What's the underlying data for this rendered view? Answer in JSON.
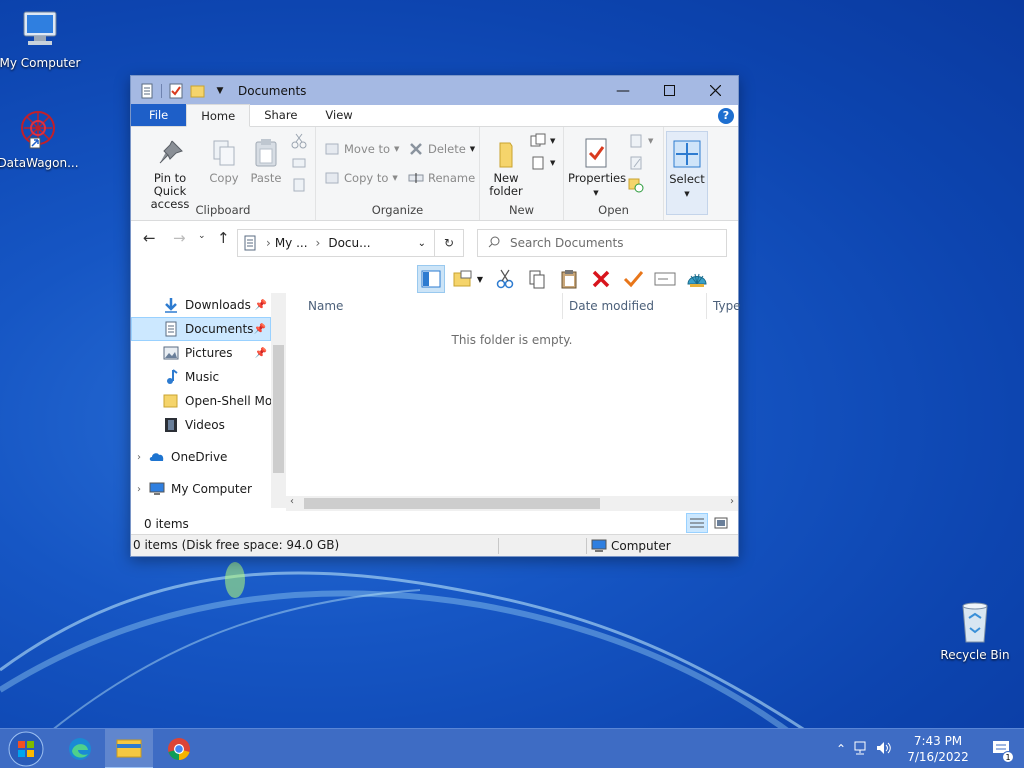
{
  "desktop": {
    "icons": [
      {
        "label": "My Computer"
      },
      {
        "label": "DataWagon..."
      },
      {
        "label": "Recycle Bin"
      }
    ]
  },
  "window": {
    "title": "Documents",
    "tabs": [
      "File",
      "Home",
      "Share",
      "View"
    ],
    "help": "?",
    "ribbon": {
      "clipboard": {
        "pin_label_1": "Pin to Quick",
        "pin_label_2": "access",
        "copy": "Copy",
        "paste": "Paste",
        "group": "Clipboard"
      },
      "organize": {
        "move_to": "Move to",
        "copy_to": "Copy to",
        "delete": "Delete",
        "rename": "Rename",
        "group": "Organize"
      },
      "new": {
        "new_folder_1": "New",
        "new_folder_2": "folder",
        "group": "New"
      },
      "open": {
        "properties": "Properties",
        "group": "Open"
      },
      "select": {
        "label": "Select"
      }
    },
    "address": {
      "crumbs": [
        "My ...",
        "Docu..."
      ],
      "search_placeholder": "Search Documents"
    },
    "nav_pane": {
      "items": [
        {
          "label": "Downloads",
          "pinned": true
        },
        {
          "label": "Documents",
          "pinned": true,
          "selected": true
        },
        {
          "label": "Pictures",
          "pinned": true
        },
        {
          "label": "Music",
          "pinned": false
        },
        {
          "label": "Open-Shell Mod",
          "pinned": false
        },
        {
          "label": "Videos",
          "pinned": false
        },
        {
          "label": "OneDrive",
          "pinned": false
        },
        {
          "label": "My Computer",
          "pinned": false
        }
      ]
    },
    "columns": [
      "Name",
      "Date modified",
      "Type"
    ],
    "empty_text": "This folder is empty.",
    "item_count": "0 items",
    "status": {
      "left": "0 items (Disk free space: 94.0 GB)",
      "right": "Computer"
    }
  },
  "taskbar": {
    "apps": [
      "start-orb",
      "edge",
      "file-explorer",
      "chrome"
    ],
    "clock_time": "7:43 PM",
    "clock_date": "7/16/2022",
    "notification_count": "1"
  },
  "colors": {
    "accent": "#1e5fc8",
    "titlebar": "#a5b9e3",
    "taskbar": "#3e6cc4",
    "selection": "#cce8ff"
  }
}
